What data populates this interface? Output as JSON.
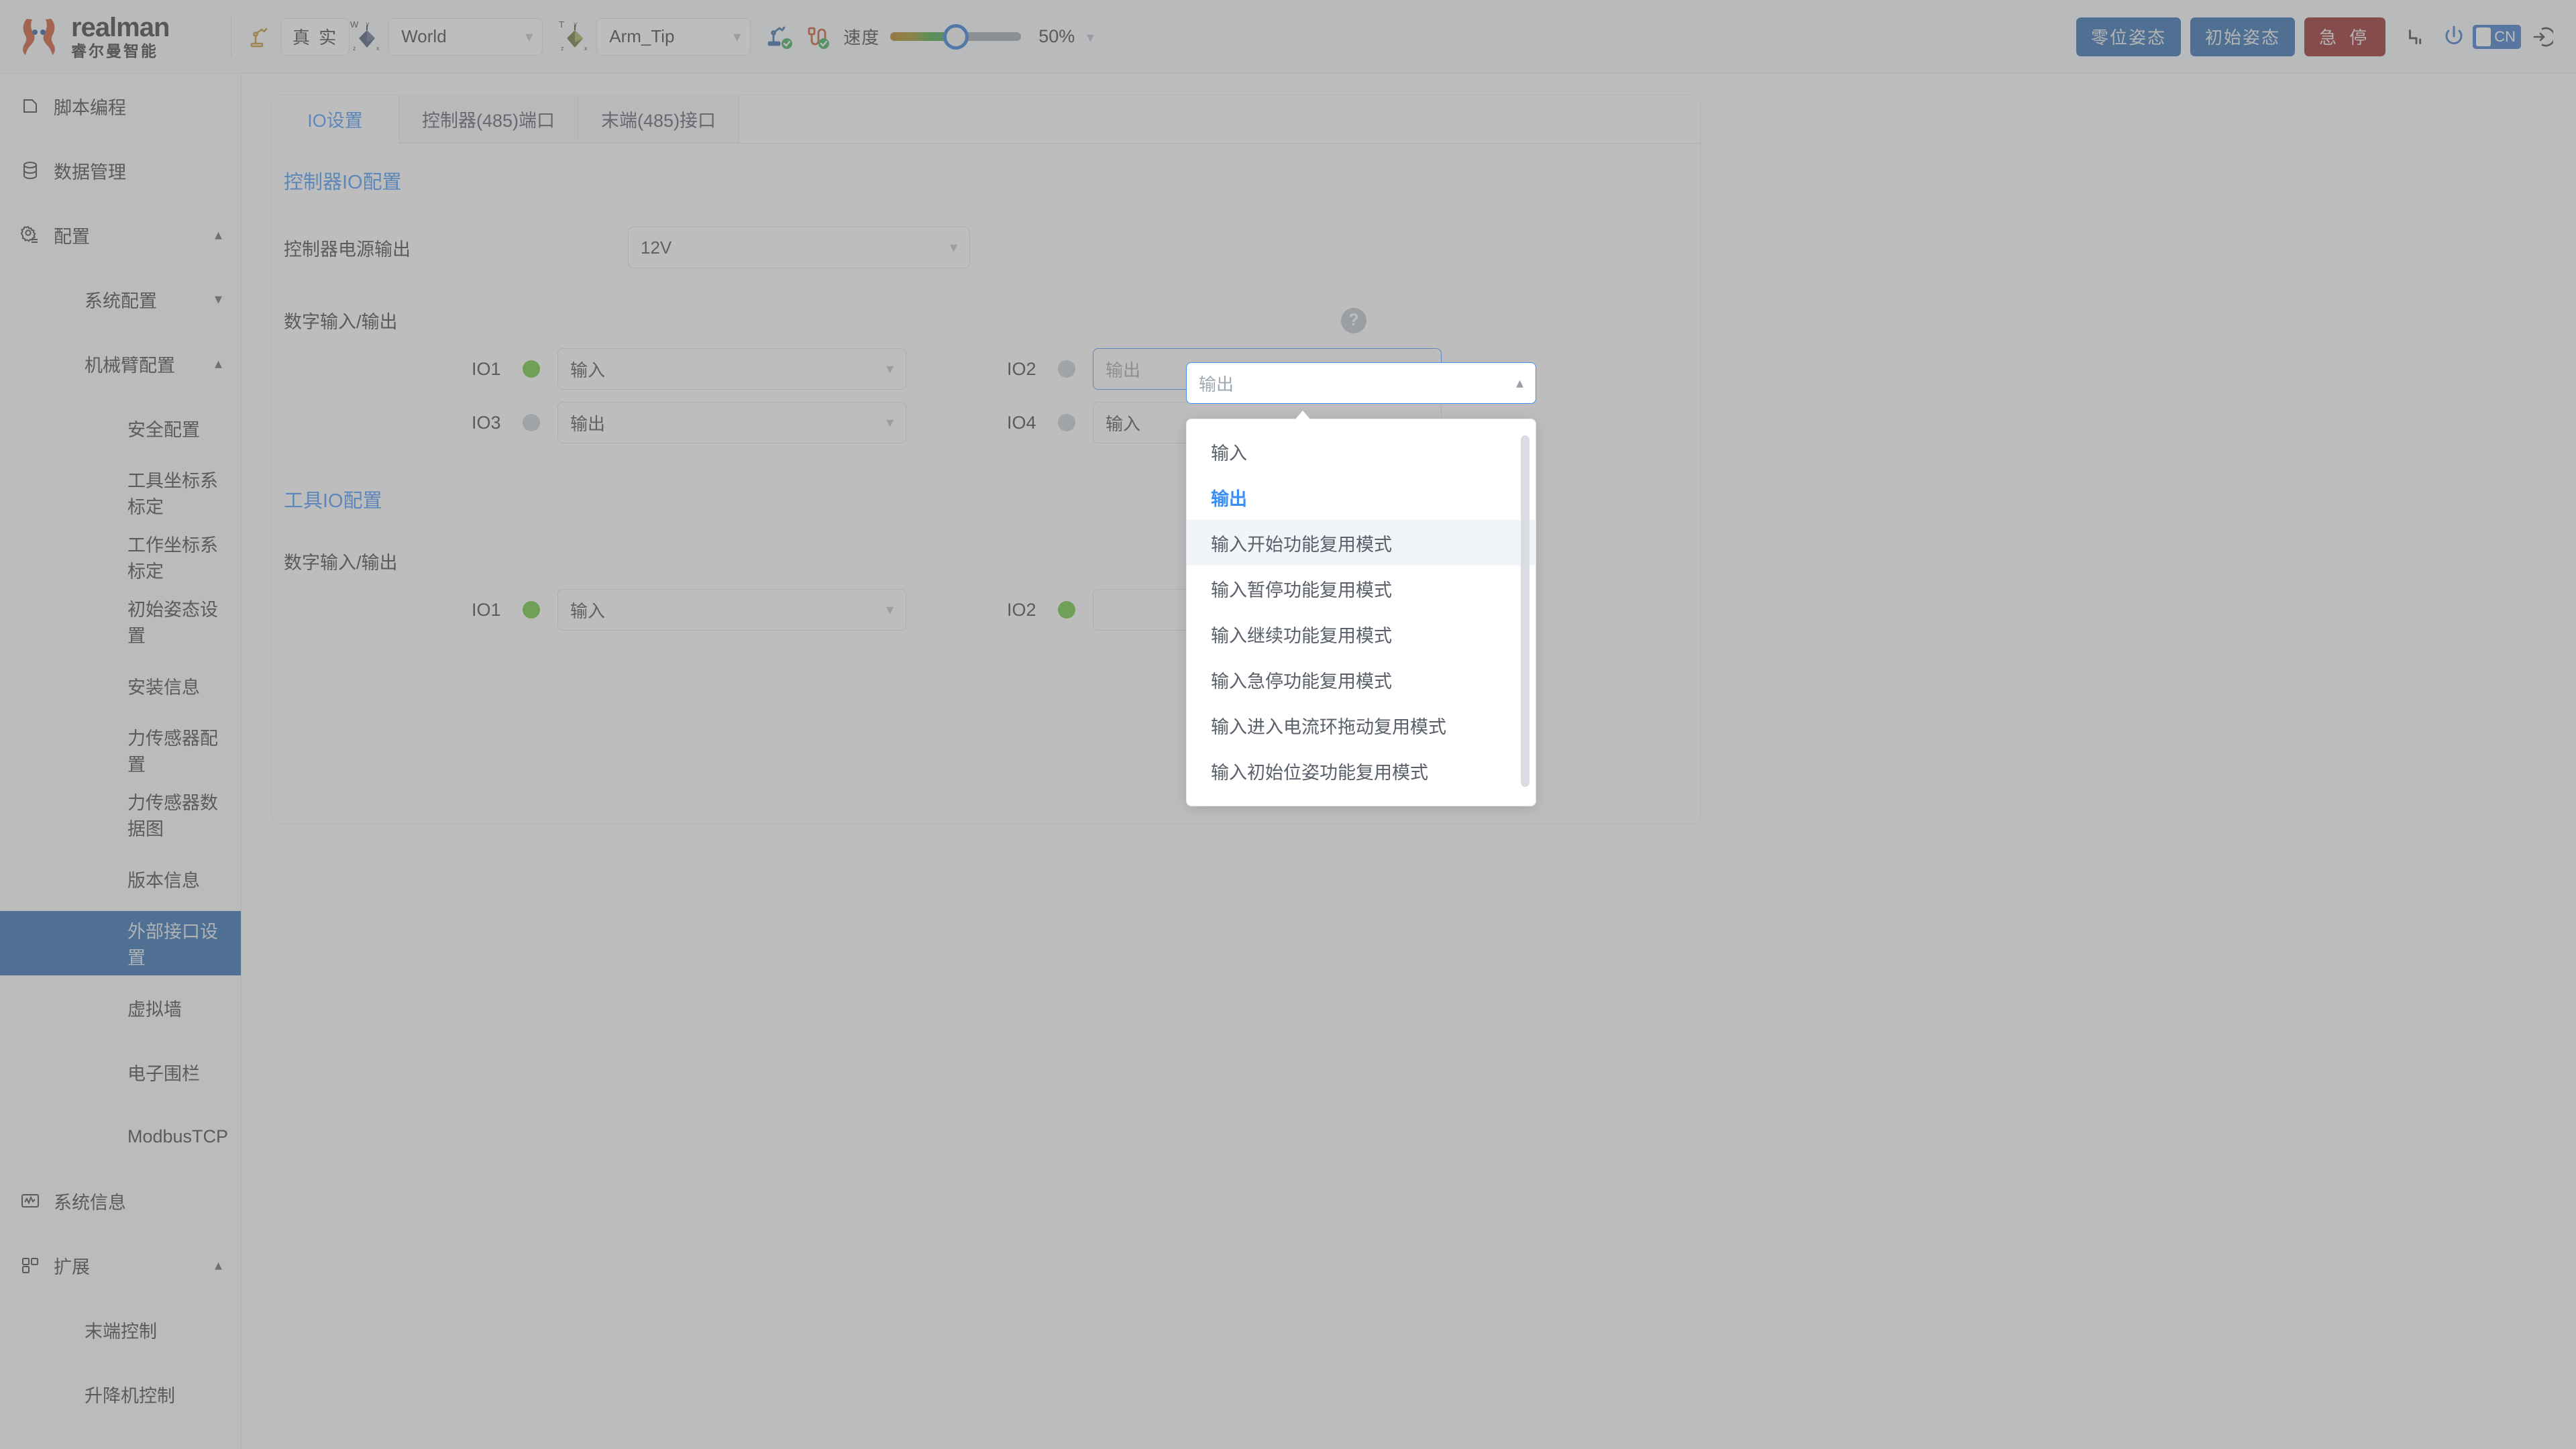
{
  "header": {
    "brand_word": "realman",
    "brand_cn": "睿尔曼智能",
    "robot_icon": "robot-arm-icon",
    "mode_button": "真 实",
    "world_axis_icon": "world-axis-icon",
    "world_axis_tag": "W",
    "frame_select_value": "World",
    "tool_axis_icon": "tool-axis-icon",
    "tool_axis_tag": "T",
    "tool_select_value": "Arm_Tip",
    "arm_status_icon": "robot-connected-icon",
    "cable_status_icon": "cable-connected-icon",
    "speed_label": "速度",
    "speed_percent": "50%",
    "speed_value": 50,
    "zero_pose_button": "零位姿态",
    "init_pose_button": "初始姿态",
    "estop_button": "急 停",
    "joint_icon": "joint-icon",
    "power_icon": "power-icon",
    "lang_badge": "CN",
    "logout_icon": "logout-icon",
    "accent_blue": "#1b5fa8",
    "danger_red": "#8c1414"
  },
  "sidebar": {
    "items": [
      {
        "label": "脚本编程",
        "icon": "script-icon",
        "level": 1,
        "arrow": "",
        "active": false
      },
      {
        "label": "数据管理",
        "icon": "database-icon",
        "level": 1,
        "arrow": "",
        "active": false
      },
      {
        "label": "配置",
        "icon": "gear-icon",
        "level": 1,
        "arrow": "chevron-up",
        "active": false
      },
      {
        "label": "系统配置",
        "icon": "",
        "level": 2,
        "arrow": "chevron-down",
        "active": false
      },
      {
        "label": "机械臂配置",
        "icon": "",
        "level": 2,
        "arrow": "chevron-up",
        "active": false
      },
      {
        "label": "安全配置",
        "icon": "",
        "level": 3,
        "arrow": "",
        "active": false
      },
      {
        "label": "工具坐标系标定",
        "icon": "",
        "level": 3,
        "arrow": "",
        "active": false
      },
      {
        "label": "工作坐标系标定",
        "icon": "",
        "level": 3,
        "arrow": "",
        "active": false
      },
      {
        "label": "初始姿态设置",
        "icon": "",
        "level": 3,
        "arrow": "",
        "active": false
      },
      {
        "label": "安装信息",
        "icon": "",
        "level": 3,
        "arrow": "",
        "active": false
      },
      {
        "label": "力传感器配置",
        "icon": "",
        "level": 3,
        "arrow": "",
        "active": false
      },
      {
        "label": "力传感器数据图",
        "icon": "",
        "level": 3,
        "arrow": "",
        "active": false
      },
      {
        "label": "版本信息",
        "icon": "",
        "level": 3,
        "arrow": "",
        "active": false
      },
      {
        "label": "外部接口设置",
        "icon": "",
        "level": 3,
        "arrow": "",
        "active": true
      },
      {
        "label": "虚拟墙",
        "icon": "",
        "level": 3,
        "arrow": "",
        "active": false
      },
      {
        "label": "电子围栏",
        "icon": "",
        "level": 3,
        "arrow": "",
        "active": false
      },
      {
        "label": "ModbusTCP",
        "icon": "",
        "level": 3,
        "arrow": "",
        "active": false
      },
      {
        "label": "系统信息",
        "icon": "chart-icon",
        "level": 1,
        "arrow": "",
        "active": false
      },
      {
        "label": "扩展",
        "icon": "grid-icon",
        "level": 1,
        "arrow": "chevron-up",
        "active": false
      },
      {
        "label": "末端控制",
        "icon": "",
        "level": 2,
        "arrow": "",
        "active": false
      },
      {
        "label": "升降机控制",
        "icon": "",
        "level": 2,
        "arrow": "",
        "active": false
      }
    ]
  },
  "main": {
    "tabs": [
      {
        "label": "IO设置",
        "active": true
      },
      {
        "label": "控制器(485)端口",
        "active": false
      },
      {
        "label": "末端(485)接口",
        "active": false
      }
    ],
    "controller_section": {
      "title": "控制器IO配置",
      "power_output_label": "控制器电源输出",
      "power_output_value": "12V",
      "digital_io_label": "数字输入/输出",
      "help_icon": "help-icon",
      "rows": [
        [
          {
            "name": "IO1",
            "state": "on",
            "value": "输入",
            "focused": false
          },
          {
            "name": "IO2",
            "state": "off",
            "value": "输出",
            "focused": true
          }
        ],
        [
          {
            "name": "IO3",
            "state": "off",
            "value": "输出",
            "focused": false
          },
          {
            "name": "IO4",
            "state": "off",
            "value": "输入",
            "focused": false
          }
        ]
      ]
    },
    "tool_section": {
      "title": "工具IO配置",
      "digital_io_label": "数字输入/输出",
      "rows": [
        [
          {
            "name": "IO1",
            "state": "on",
            "value": "输入",
            "focused": false
          },
          {
            "name": "IO2",
            "state": "on",
            "value": "",
            "focused": false
          }
        ]
      ]
    }
  },
  "dropdown": {
    "open": true,
    "options": [
      {
        "label": "输入",
        "selected": false,
        "hovered": false
      },
      {
        "label": "输出",
        "selected": true,
        "hovered": false
      },
      {
        "label": "输入开始功能复用模式",
        "selected": false,
        "hovered": true
      },
      {
        "label": "输入暂停功能复用模式",
        "selected": false,
        "hovered": false
      },
      {
        "label": "输入继续功能复用模式",
        "selected": false,
        "hovered": false
      },
      {
        "label": "输入急停功能复用模式",
        "selected": false,
        "hovered": false
      },
      {
        "label": "输入进入电流环拖动复用模式",
        "selected": false,
        "hovered": false
      },
      {
        "label": "输入初始位姿功能复用模式",
        "selected": false,
        "hovered": false
      }
    ],
    "trigger_value": "输出",
    "trigger_chevron": "chevron-up-icon"
  }
}
